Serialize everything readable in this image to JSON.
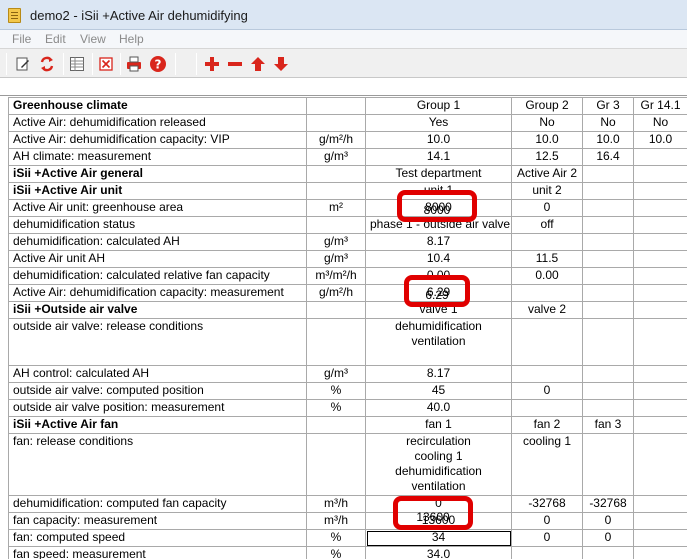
{
  "window": {
    "title": "demo2 - iSii +Active Air dehumidifying"
  },
  "menu": [
    "File",
    "Edit",
    "View",
    "Help"
  ],
  "toolbar": {
    "icons": [
      "edit-icon",
      "refresh-icon",
      "table-icon",
      "delete-icon",
      "print-icon",
      "help-icon",
      "add-icon",
      "remove-icon",
      "arrow-up-icon",
      "arrow-down-icon"
    ],
    "colors": {
      "red": "#d9261c",
      "accent": "#e00000"
    }
  },
  "grid": {
    "rows": [
      {
        "type": "header",
        "label": "Greenhouse climate",
        "unit": "",
        "cells": [
          "Group 1",
          "Group 2",
          "Gr 3",
          "Gr 14.1"
        ]
      },
      {
        "type": "data",
        "label": "Active Air: dehumidification released",
        "unit": "",
        "cells": [
          "Yes",
          "No",
          "No",
          "No"
        ]
      },
      {
        "type": "data",
        "label": "Active Air: dehumidification capacity: VIP",
        "unit": "g/m²/h",
        "cells": [
          "10.0",
          "10.0",
          "10.0",
          "10.0"
        ]
      },
      {
        "type": "data",
        "label": "AH climate: measurement",
        "unit": "g/m³",
        "cells": [
          "14.1",
          "12.5",
          "16.4",
          ""
        ]
      },
      {
        "type": "header",
        "label": "iSii +Active Air general",
        "unit": "",
        "cells": [
          "Test department",
          "Active Air 2",
          "",
          ""
        ]
      },
      {
        "type": "header",
        "label": "iSii +Active Air unit",
        "unit": "",
        "cells": [
          "unit 1",
          "unit 2",
          "",
          ""
        ]
      },
      {
        "type": "data",
        "label": "Active Air unit: greenhouse area",
        "unit": "m²",
        "cells": [
          "8000",
          "0",
          "",
          ""
        ]
      },
      {
        "type": "data",
        "label": "dehumidification status",
        "unit": "",
        "cells": [
          "phase 1 - outside air valve",
          "off",
          "",
          ""
        ]
      },
      {
        "type": "data",
        "label": "dehumidification: calculated AH",
        "unit": "g/m³",
        "cells": [
          "8.17",
          "",
          "",
          ""
        ]
      },
      {
        "type": "data",
        "label": "Active Air unit AH",
        "unit": "g/m³",
        "cells": [
          "10.4",
          "11.5",
          "",
          ""
        ]
      },
      {
        "type": "data",
        "label": "dehumidification: calculated relative fan capacity",
        "unit": "m³/m²/h",
        "cells": [
          "0.00",
          "0.00",
          "",
          ""
        ]
      },
      {
        "type": "data",
        "label": "Active Air: dehumidification capacity: measurement",
        "unit": "g/m²/h",
        "cells": [
          "6.29",
          "",
          "",
          ""
        ]
      },
      {
        "type": "header",
        "label": "iSii +Outside air valve",
        "unit": "",
        "cells": [
          "valve 1",
          "valve 2",
          "",
          ""
        ]
      },
      {
        "type": "data",
        "label": "outside air valve: release conditions",
        "unit": "",
        "lines": 3,
        "cells": [
          [
            "dehumidification",
            "ventilation"
          ],
          [],
          [],
          []
        ]
      },
      {
        "type": "data",
        "label": "AH control: calculated AH",
        "unit": "g/m³",
        "cells": [
          "8.17",
          "",
          "",
          ""
        ]
      },
      {
        "type": "data",
        "label": "outside air valve: computed position",
        "unit": "%",
        "cells": [
          "45",
          "0",
          "",
          ""
        ]
      },
      {
        "type": "data",
        "label": "outside air valve position: measurement",
        "unit": "%",
        "cells": [
          "40.0",
          "",
          "",
          ""
        ]
      },
      {
        "type": "header",
        "label": "iSii +Active Air fan",
        "unit": "",
        "cells": [
          "fan 1",
          "fan 2",
          "fan 3",
          ""
        ]
      },
      {
        "type": "data",
        "label": "fan: release conditions",
        "unit": "",
        "lines": 4,
        "cells": [
          [
            "recirculation",
            "cooling 1",
            "dehumidification",
            "ventilation"
          ],
          [
            "cooling 1"
          ],
          [],
          []
        ]
      },
      {
        "type": "data",
        "label": "dehumidification: computed fan capacity",
        "unit": "m³/h",
        "cells": [
          "0",
          "-32768",
          "-32768",
          ""
        ]
      },
      {
        "type": "data",
        "label": "fan capacity: measurement",
        "unit": "m³/h",
        "cells": [
          "13600",
          "0",
          "0",
          ""
        ]
      },
      {
        "type": "data",
        "label": "fan: computed speed",
        "unit": "%",
        "selected": 0,
        "cells": [
          "34",
          "0",
          "0",
          ""
        ]
      },
      {
        "type": "data",
        "label": "fan speed: measurement",
        "unit": "%",
        "cells": [
          "34.0",
          "",
          "",
          ""
        ]
      }
    ]
  },
  "highlights": [
    {
      "value": "8000"
    },
    {
      "value": "6.29"
    },
    {
      "value": "13600"
    }
  ]
}
